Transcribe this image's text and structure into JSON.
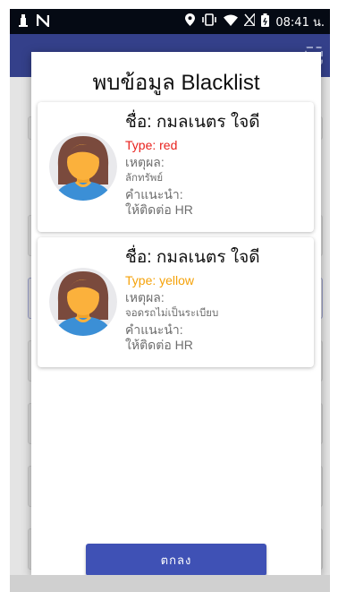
{
  "status_bar": {
    "time": "08:41 น.",
    "left_icons": [
      "notification-icon",
      "n-icon"
    ],
    "right_icons": [
      "location-icon",
      "vibrate-icon",
      "wifi-icon",
      "no-sim-icon",
      "battery-icon"
    ]
  },
  "dialog": {
    "title": "พบข้อมูล Blacklist",
    "ok_label": "ตกลง"
  },
  "records": [
    {
      "name": "ชื่อ: กมลเนตร ใจดี",
      "type": "Type: red",
      "type_color": "#e8211d",
      "reason_label": "เหตุผล:",
      "reason": "ลักทรัพย์",
      "advice_label": "คำแนะนำ:",
      "advice": "ให้ติดต่อ HR"
    },
    {
      "name": "ชื่อ: กมลเนตร ใจดี",
      "type": "Type: yellow",
      "type_color": "#f5a20a",
      "reason_label": "เหตุผล:",
      "reason": "จอดรถไม่เป็นระเบียบ",
      "advice_label": "คำแนะนำ:",
      "advice": "ให้ติดต่อ HR"
    }
  ],
  "colors": {
    "app_bar": "#34408a",
    "button": "#3f51b5"
  }
}
